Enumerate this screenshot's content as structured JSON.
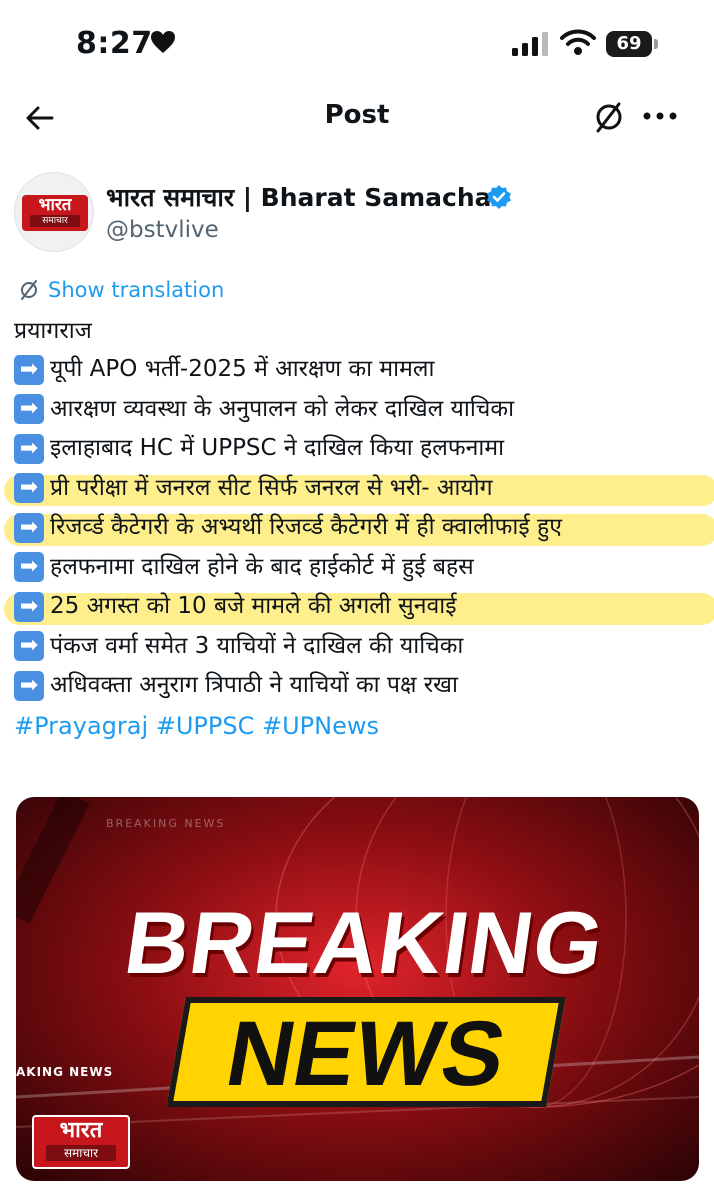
{
  "status_bar": {
    "time": "8:27",
    "battery": "69"
  },
  "nav": {
    "title": "Post"
  },
  "author": {
    "name": "भारत समाचार | Bharat Samachar",
    "handle": "@bstvlive",
    "avatar_text_top": "भारत",
    "avatar_text_bottom": "समाचार"
  },
  "show_translation": "Show translation",
  "post": {
    "heading": "प्रयागराज",
    "arrow_glyph": "➡",
    "lines": [
      {
        "text": "यूपी APO भर्ती-2025 में आरक्षण का मामला",
        "highlighted": false
      },
      {
        "text": "आरक्षण व्यवस्था के अनुपालन को लेकर दाखिल याचिका",
        "highlighted": false
      },
      {
        "text": "इलाहाबाद HC में UPPSC ने दाखिल किया हलफनामा",
        "highlighted": false
      },
      {
        "text": "प्री परीक्षा में जनरल सीट सिर्फ जनरल से भरी- आयोग",
        "highlighted": true
      },
      {
        "text": "रिजर्व्ड कैटेगरी के अभ्यर्थी रिजर्व्ड कैटेगरी में ही क्वालीफाई हुए",
        "highlighted": true
      },
      {
        "text": "हलफनामा दाखिल होने के बाद हाईकोर्ट में हुई बहस",
        "highlighted": false
      },
      {
        "text": "25 अगस्त को 10 बजे मामले की अगली सुनवाई",
        "highlighted": true
      },
      {
        "text": "पंकज वर्मा समेत 3 याचियों ने दाखिल की याचिका",
        "highlighted": false
      },
      {
        "text": "अधिवक्ता अनुराग त्रिपाठी ने याचियों का पक्ष रखा",
        "highlighted": false
      }
    ],
    "hashtags": "#Prayagraj #UPPSC #UPNews"
  },
  "image": {
    "headline_top": "BREAKING",
    "headline_bottom": "NEWS",
    "ticker": "AKING NEWS",
    "bg_ticker": "BREAKING NEWS",
    "logo_top": "भारत",
    "logo_bottom": "समाचार"
  },
  "colors": {
    "link": "#1d9bf0",
    "highlight": "#ffe85f",
    "arrow_bg": "#4a90e2",
    "brand_red": "#c8161d",
    "banner_yellow": "#ffd400"
  },
  "icons": [
    "heart-icon",
    "signal-icon",
    "wifi-icon",
    "battery-icon",
    "back-arrow-icon",
    "translate-icon",
    "more-icon",
    "verified-icon",
    "arrow-right-icon"
  ]
}
